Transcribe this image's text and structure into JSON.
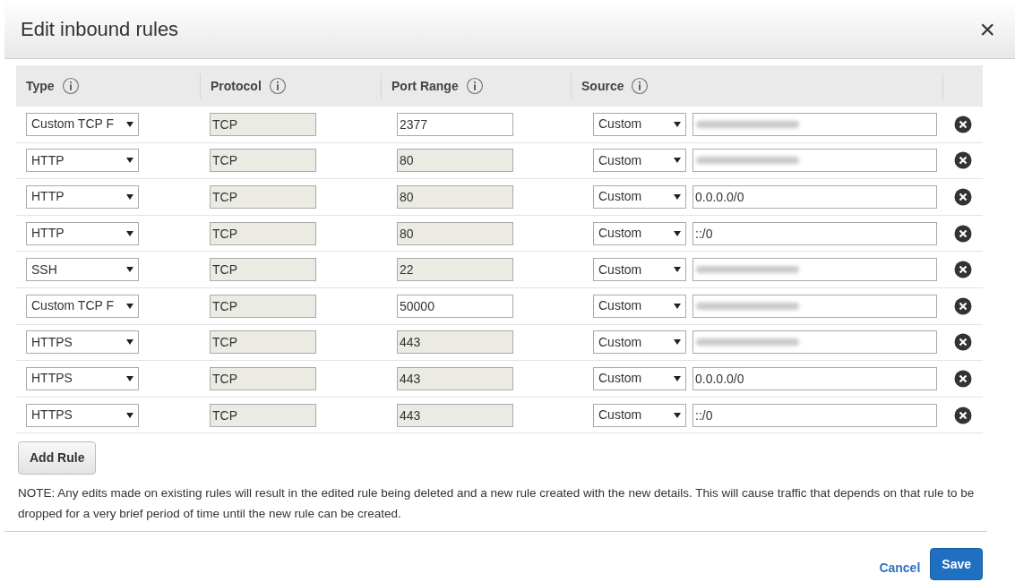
{
  "dialog": {
    "title": "Edit inbound rules",
    "close": "×"
  },
  "table": {
    "columns": [
      "Type",
      "Protocol",
      "Port Range",
      "Source"
    ],
    "rows": [
      {
        "type": "Custom TCP F",
        "protocol": "TCP",
        "port": "2377",
        "port_disabled": false,
        "source_type": "Custom",
        "redacted": true
      },
      {
        "type": "HTTP",
        "protocol": "TCP",
        "port": "80",
        "port_disabled": true,
        "source_type": "Custom",
        "redacted": true
      },
      {
        "type": "HTTP",
        "protocol": "TCP",
        "port": "80",
        "port_disabled": true,
        "source_type": "Custom",
        "source": "0.0.0.0/0",
        "redacted": false
      },
      {
        "type": "HTTP",
        "protocol": "TCP",
        "port": "80",
        "port_disabled": true,
        "source_type": "Custom",
        "source": "::/0",
        "redacted": false
      },
      {
        "type": "SSH",
        "protocol": "TCP",
        "port": "22",
        "port_disabled": true,
        "source_type": "Custom",
        "redacted": true
      },
      {
        "type": "Custom TCP F",
        "protocol": "TCP",
        "port": "50000",
        "port_disabled": false,
        "source_type": "Custom",
        "redacted": true
      },
      {
        "type": "HTTPS",
        "protocol": "TCP",
        "port": "443",
        "port_disabled": true,
        "source_type": "Custom",
        "redacted": true
      },
      {
        "type": "HTTPS",
        "protocol": "TCP",
        "port": "443",
        "port_disabled": true,
        "source_type": "Custom",
        "source": "0.0.0.0/0",
        "redacted": false
      },
      {
        "type": "HTTPS",
        "protocol": "TCP",
        "port": "443",
        "port_disabled": true,
        "source_type": "Custom",
        "source": "::/0",
        "redacted": false
      }
    ]
  },
  "add_button": "Add Rule",
  "note": "NOTE: Any edits made on existing rules will result in the edited rule being deleted and a new rule created with the new details. This will cause traffic that depends on that rule to be dropped for a very brief period of time until the new rule can be created.",
  "buttons": {
    "cancel": "Cancel",
    "save": "Save"
  }
}
